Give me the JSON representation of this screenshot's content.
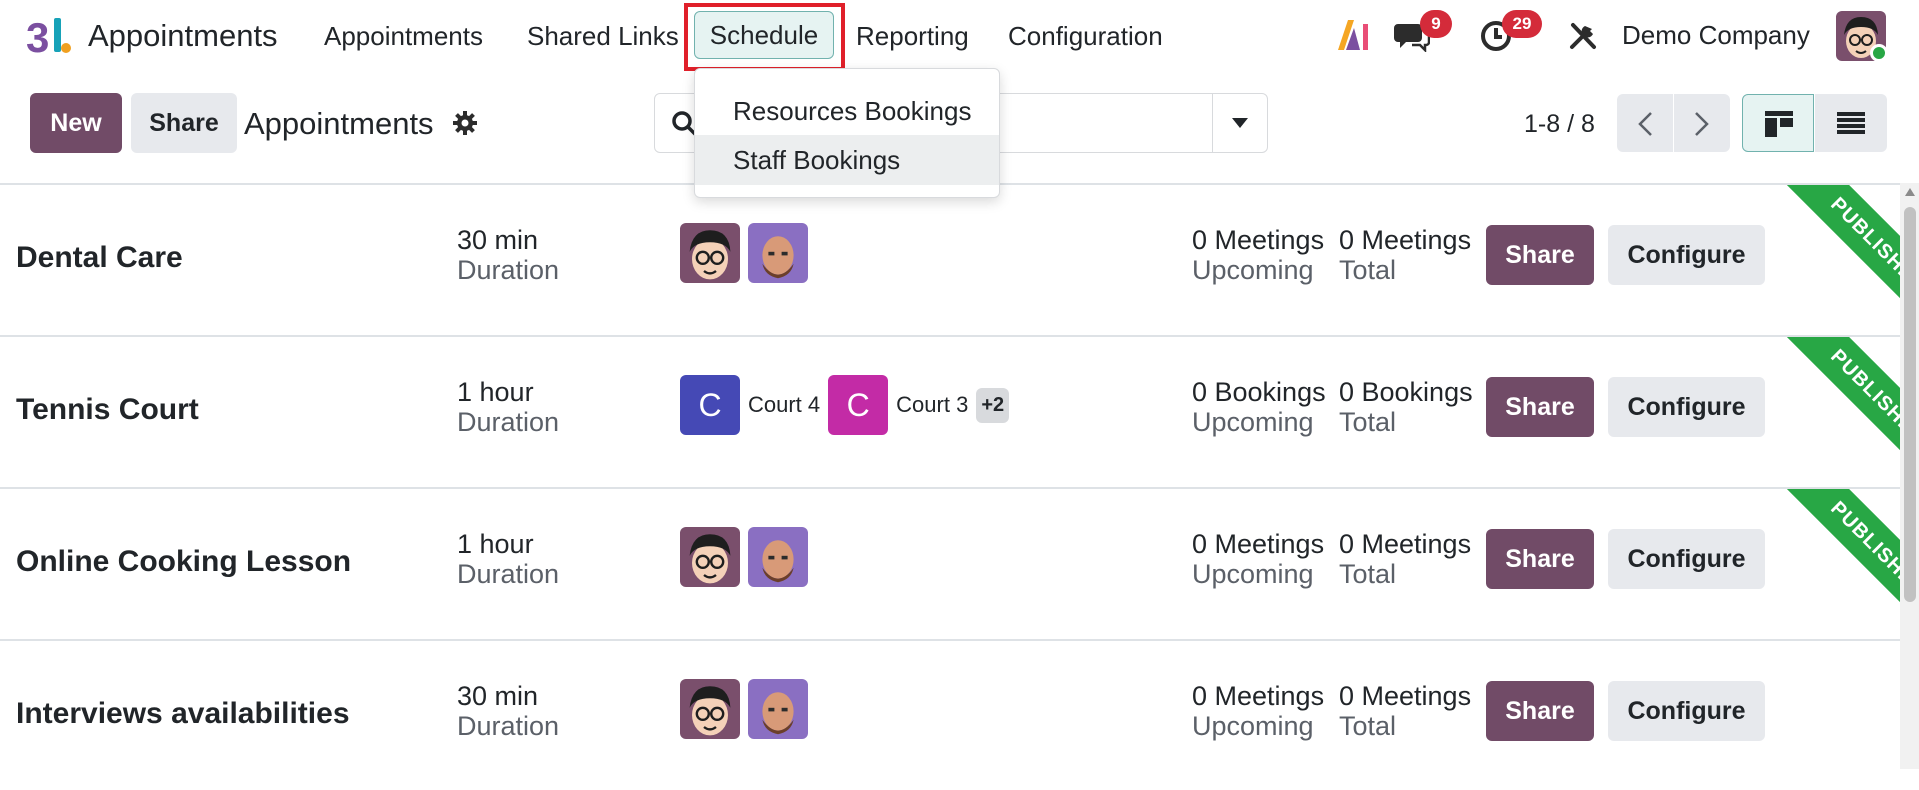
{
  "navbar": {
    "app_name": "Appointments",
    "menu": [
      "Appointments",
      "Shared Links",
      "Schedule",
      "Reporting",
      "Configuration"
    ],
    "active_menu": "Schedule",
    "messages_count": "9",
    "activities_count": "29",
    "company": "Demo Company"
  },
  "schedule_dropdown": {
    "items": [
      "Resources Bookings",
      "Staff Bookings"
    ]
  },
  "control_panel": {
    "new_label": "New",
    "share_label": "Share",
    "breadcrumb": "Appointments",
    "pager": "1-8 / 8"
  },
  "rows": [
    {
      "name": "Dental Care",
      "duration": "30 min",
      "duration_label": "Duration",
      "upcoming": "0 Meetings",
      "upcoming_label": "Upcoming",
      "total": "0 Meetings",
      "total_label": "Total",
      "share_label": "Share",
      "configure_label": "Configure",
      "ribbon": "PUBLISHED"
    },
    {
      "name": "Tennis Court",
      "duration": "1 hour",
      "duration_label": "Duration",
      "resources": [
        {
          "initial": "C",
          "label": "Court 4",
          "color": "#4549b5"
        },
        {
          "initial": "C",
          "label": "Court 3",
          "color": "#c32ba6"
        }
      ],
      "more": "+2",
      "upcoming": "0 Bookings",
      "upcoming_label": "Upcoming",
      "total": "0 Bookings",
      "total_label": "Total",
      "share_label": "Share",
      "configure_label": "Configure",
      "ribbon": "PUBLISHED"
    },
    {
      "name": "Online Cooking Lesson",
      "duration": "1 hour",
      "duration_label": "Duration",
      "upcoming": "0 Meetings",
      "upcoming_label": "Upcoming",
      "total": "0 Meetings",
      "total_label": "Total",
      "share_label": "Share",
      "configure_label": "Configure",
      "ribbon": "PUBLISHED"
    },
    {
      "name": "Interviews availabilities",
      "duration": "30 min",
      "duration_label": "Duration",
      "upcoming": "0 Meetings",
      "upcoming_label": "Upcoming",
      "total": "0 Meetings",
      "total_label": "Total",
      "share_label": "Share",
      "configure_label": "Configure"
    }
  ],
  "colors": {
    "primary": "#714b67",
    "published_ribbon": "#28a745",
    "badge": "#d42b3a",
    "highlight_box": "#e0202a"
  }
}
